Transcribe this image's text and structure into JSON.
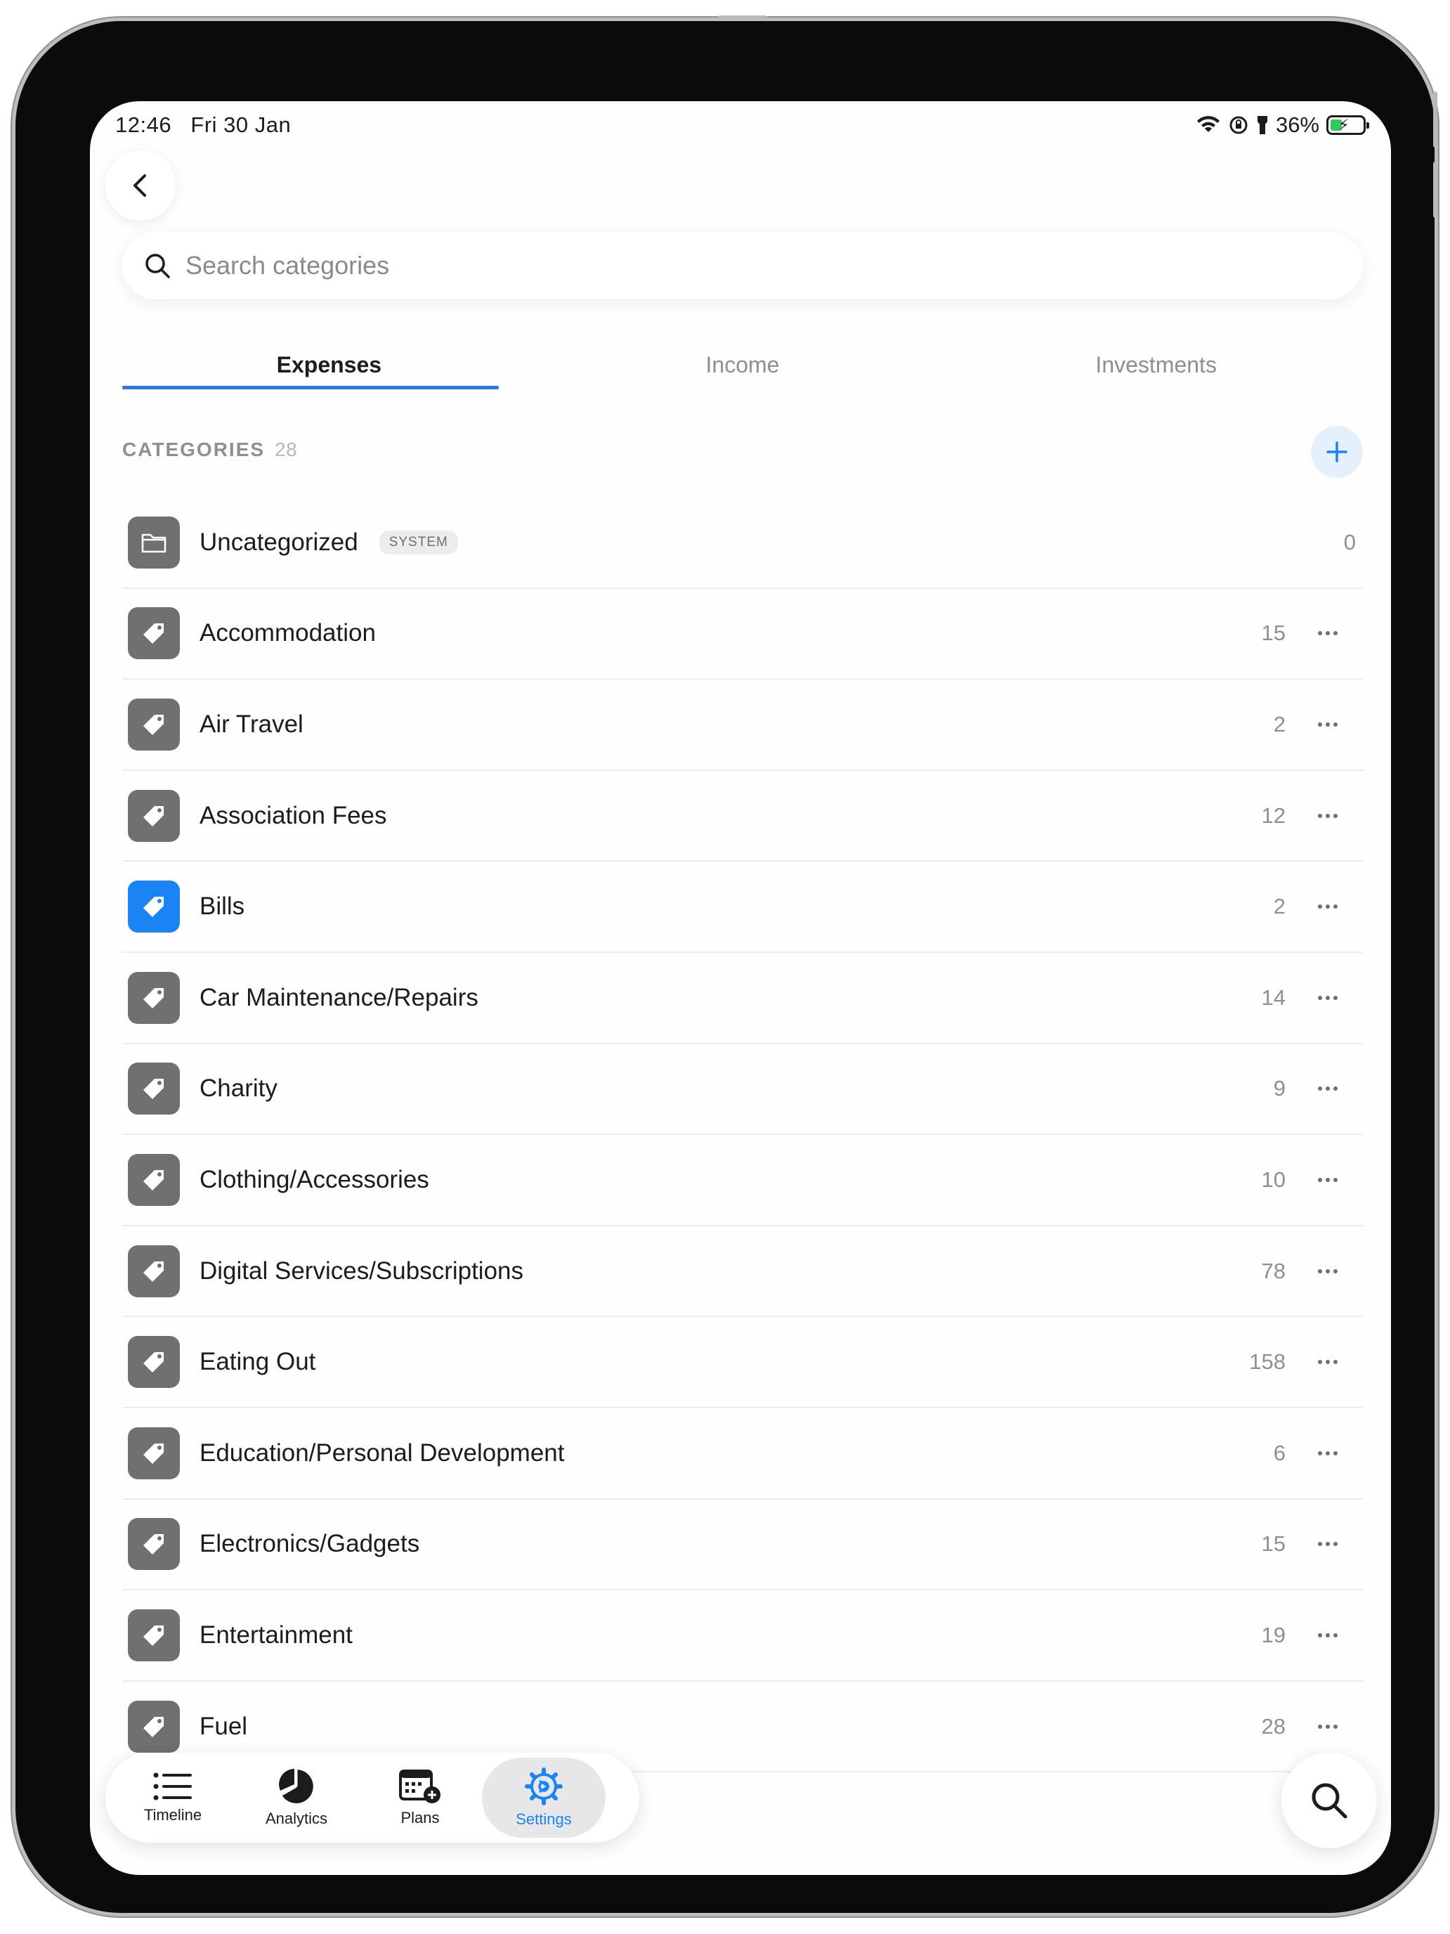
{
  "status": {
    "time": "12:46",
    "date": "Fri 30 Jan",
    "battery": "36%",
    "battery_level": 0.36
  },
  "search": {
    "placeholder": "Search categories"
  },
  "tabs": [
    {
      "label": "Expenses",
      "active": true
    },
    {
      "label": "Income",
      "active": false
    },
    {
      "label": "Investments",
      "active": false
    }
  ],
  "section": {
    "title": "CATEGORIES",
    "count": "28"
  },
  "categories": [
    {
      "name": "Uncategorized",
      "badge": "SYSTEM",
      "count": "0",
      "icon": "folder-icon"
    },
    {
      "name": "Accommodation",
      "count": "15",
      "icon": "tag-icon"
    },
    {
      "name": "Air Travel",
      "count": "2",
      "icon": "tag-icon"
    },
    {
      "name": "Association Fees",
      "count": "12",
      "icon": "tag-icon"
    },
    {
      "name": "Bills",
      "count": "2",
      "icon": "tag-icon",
      "color": "#1a84f5"
    },
    {
      "name": "Car Maintenance/Repairs",
      "count": "14",
      "icon": "tag-icon"
    },
    {
      "name": "Charity",
      "count": "9",
      "icon": "tag-icon"
    },
    {
      "name": "Clothing/Accessories",
      "count": "10",
      "icon": "tag-icon"
    },
    {
      "name": "Digital Services/Subscriptions",
      "count": "78",
      "icon": "tag-icon"
    },
    {
      "name": "Eating Out",
      "count": "158",
      "icon": "tag-icon"
    },
    {
      "name": "Education/Personal Development",
      "count": "6",
      "icon": "tag-icon"
    },
    {
      "name": "Electronics/Gadgets",
      "count": "15",
      "icon": "tag-icon"
    },
    {
      "name": "Entertainment",
      "count": "19",
      "icon": "tag-icon"
    },
    {
      "name": "Fuel",
      "count": "28",
      "icon": "tag-icon"
    }
  ],
  "tabbar": [
    {
      "label": "Timeline",
      "icon": "list-icon",
      "active": false
    },
    {
      "label": "Analytics",
      "icon": "pie-chart-icon",
      "active": false
    },
    {
      "label": "Plans",
      "icon": "calendar-plus-icon",
      "active": false
    },
    {
      "label": "Settings",
      "icon": "gear-icon",
      "active": true
    }
  ],
  "colors": {
    "accent": "#1a84f5",
    "tab_underline": "#2f7ad8",
    "icon_gray": "#707070"
  }
}
